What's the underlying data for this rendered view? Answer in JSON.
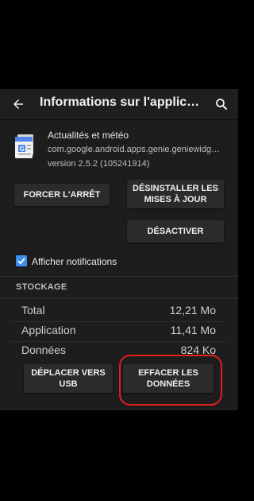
{
  "appbar": {
    "title": "Informations sur l'applicat…",
    "back_icon": "arrow-left-icon",
    "search_icon": "search-icon"
  },
  "app": {
    "name": "Actualités et météo",
    "package": "com.google.android.apps.genie.geniewidg…",
    "version": "version 2.5.2 (105241914)",
    "icon": "google-news-weather-icon"
  },
  "actions": {
    "force_stop": "FORCER L'ARRÊT",
    "uninstall_updates": "DÉSINSTALLER LES MISES À JOUR",
    "disable": "DÉSACTIVER"
  },
  "notifications": {
    "label": "Afficher notifications",
    "checked": true
  },
  "storage": {
    "section_title": "STOCKAGE",
    "rows": [
      {
        "label": "Total",
        "value": "12,21 Mo"
      },
      {
        "label": "Application",
        "value": "11,41 Mo"
      },
      {
        "label": "Données",
        "value": "824 Ko"
      }
    ],
    "move_usb": "DÉPLACER VERS USB",
    "clear_data": "EFFACER LES DONNÉES"
  },
  "colors": {
    "accent": "#3d8ff0",
    "highlight": "#e0201c",
    "background": "#1d1d1d"
  }
}
